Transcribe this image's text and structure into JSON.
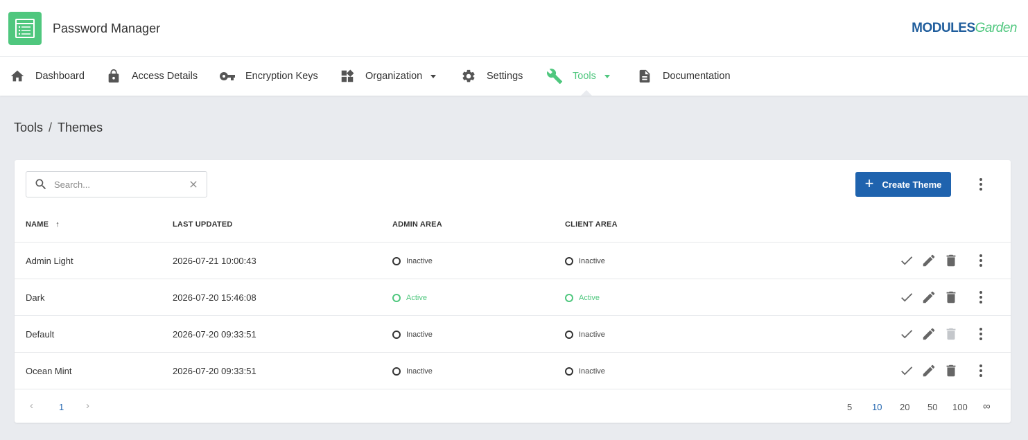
{
  "app": {
    "title": "Password Manager",
    "brand_main": "M",
    "brand_odules": "ODULES",
    "brand_garden": "Garden"
  },
  "nav": {
    "items": [
      {
        "label": "Dashboard",
        "icon": "home-icon"
      },
      {
        "label": "Access Details",
        "icon": "lock-icon"
      },
      {
        "label": "Encryption Keys",
        "icon": "key-icon"
      },
      {
        "label": "Organization",
        "icon": "widgets-icon",
        "dropdown": true
      },
      {
        "label": "Settings",
        "icon": "gear-icon"
      },
      {
        "label": "Tools",
        "icon": "wrench-icon",
        "dropdown": true,
        "active": true
      },
      {
        "label": "Documentation",
        "icon": "document-icon"
      }
    ]
  },
  "breadcrumb": {
    "parent": "Tools",
    "separator": "/",
    "current": "Themes"
  },
  "search": {
    "placeholder": "Search...",
    "value": ""
  },
  "toolbar": {
    "create_label": "Create Theme"
  },
  "table": {
    "headers": {
      "name": "NAME",
      "last_updated": "LAST UPDATED",
      "admin_area": "ADMIN AREA",
      "client_area": "CLIENT AREA"
    },
    "sort": {
      "column": "name",
      "direction": "asc"
    },
    "rows": [
      {
        "name": "Admin Light",
        "last_updated": "2026-07-21 10:00:43",
        "admin_area": "Inactive",
        "client_area": "Inactive",
        "delete_disabled": false
      },
      {
        "name": "Dark",
        "last_updated": "2026-07-20 15:46:08",
        "admin_area": "Active",
        "client_area": "Active",
        "delete_disabled": false
      },
      {
        "name": "Default",
        "last_updated": "2026-07-20 09:33:51",
        "admin_area": "Inactive",
        "client_area": "Inactive",
        "delete_disabled": true
      },
      {
        "name": "Ocean Mint",
        "last_updated": "2026-07-20 09:33:51",
        "admin_area": "Inactive",
        "client_area": "Inactive",
        "delete_disabled": false
      }
    ]
  },
  "pagination": {
    "current_page": "1",
    "prev": "‹",
    "next": "›",
    "page_sizes": [
      "5",
      "10",
      "20",
      "50",
      "100",
      "∞"
    ],
    "selected_page_size": "10"
  },
  "colors": {
    "accent": "#4fc77e",
    "primary": "#1f63ae",
    "background": "#e9ebef"
  }
}
